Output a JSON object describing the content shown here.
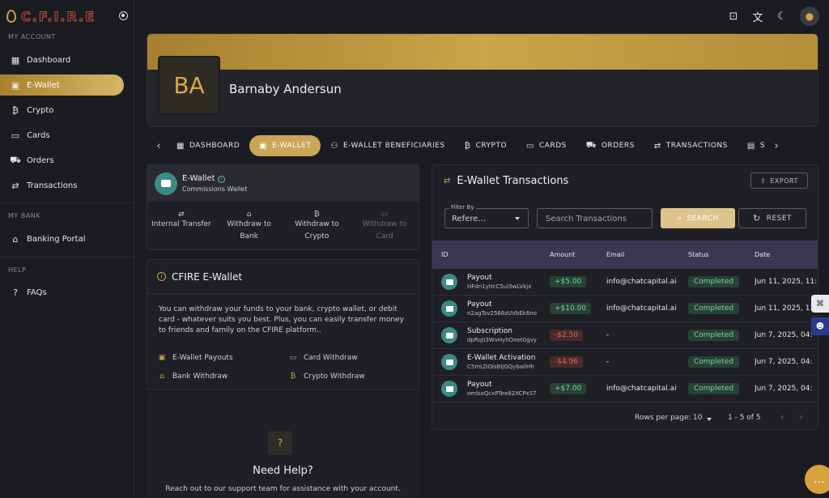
{
  "brand": {
    "logo_text": "C.F.I.R.E"
  },
  "sidebar": {
    "sections": [
      {
        "title": "MY ACCOUNT"
      },
      {
        "title": "MY BANK"
      },
      {
        "title": "HELP"
      }
    ],
    "items": [
      {
        "label": "Dashboard",
        "icon": "dashboard-icon"
      },
      {
        "label": "E-Wallet",
        "icon": "wallet-icon",
        "active": true
      },
      {
        "label": "Crypto",
        "icon": "bitcoin-icon"
      },
      {
        "label": "Cards",
        "icon": "card-icon"
      },
      {
        "label": "Orders",
        "icon": "cart-icon"
      },
      {
        "label": "Transactions",
        "icon": "swap-icon"
      },
      {
        "label": "Banking Portal",
        "icon": "bank-icon"
      },
      {
        "label": "FAQs",
        "icon": "faq-icon"
      }
    ]
  },
  "topbar": {
    "icons": [
      "presentation-icon",
      "translate-icon",
      "dark-mode-icon",
      "user-icon"
    ]
  },
  "profile": {
    "initials": "BA",
    "name": "Barnaby Andersun"
  },
  "tabs": [
    {
      "label": "DASHBOARD",
      "icon": "dashboard-icon"
    },
    {
      "label": "E-WALLET",
      "icon": "wallet-icon",
      "active": true
    },
    {
      "label": "E-WALLET BENEFICIARIES",
      "icon": "people-icon"
    },
    {
      "label": "CRYPTO",
      "icon": "bitcoin-icon"
    },
    {
      "label": "CARDS",
      "icon": "card-icon"
    },
    {
      "label": "ORDERS",
      "icon": "cart-icon"
    },
    {
      "label": "TRANSACTIONS",
      "icon": "swap-icon"
    },
    {
      "label": "S",
      "icon": "settings-icon"
    }
  ],
  "ewallet": {
    "title": "E-Wallet",
    "subtitle": "Commissions Wallet",
    "actions": [
      {
        "label": "Internal Transfer",
        "icon": "swap-icon"
      },
      {
        "label": "Withdraw to Bank",
        "icon": "bank-icon"
      },
      {
        "label": "Withdraw to Crypto",
        "icon": "bitcoin-icon"
      },
      {
        "label": "Withdraw to Card",
        "icon": "card-icon",
        "disabled": true
      }
    ]
  },
  "info": {
    "title": "CFIRE E-Wallet",
    "description": "You can withdraw your funds to your bank, crypto wallet, or debit card - whatever suits you best. Plus, you can easily transfer money to friends and family on the CFIRE platform..",
    "links": [
      {
        "label": "E-Wallet Payouts",
        "icon": "payout-icon"
      },
      {
        "label": "Card Withdraw",
        "icon": "card-icon"
      },
      {
        "label": "Bank Withdraw",
        "icon": "bank-icon"
      },
      {
        "label": "Crypto Withdraw",
        "icon": "bitcoin-icon"
      }
    ]
  },
  "help": {
    "title": "Need Help?",
    "subtitle": "Reach out to our support team for assistance with your account."
  },
  "transactions": {
    "title": "E-Wallet Transactions",
    "export_label": "EXPORT",
    "filter_label": "Filter By",
    "filter_value": "Refere...",
    "search_placeholder": "Search Transactions",
    "search_label": "SEARCH",
    "reset_label": "RESET",
    "columns": [
      "ID",
      "Amount",
      "Email",
      "Status",
      "Date"
    ],
    "rows": [
      {
        "type": "Payout",
        "ref": "HFdn1ytIcC5ul3wLVkjx",
        "amount": "+$5.00",
        "sign": "pos",
        "email": "info@chatcapital.ai",
        "status": "Completed",
        "date": "Jun 11, 2025, 11:"
      },
      {
        "type": "Payout",
        "ref": "n2agTsv2566zUVbEk6no",
        "amount": "+$10.00",
        "sign": "pos",
        "email": "info@chatcapital.ai",
        "status": "Completed",
        "date": "Jun 11, 2025, 11:"
      },
      {
        "type": "Subscription",
        "ref": "dpRqII3WvHyhOnet0gvy",
        "amount": "-$2.50",
        "sign": "neg",
        "email": "-",
        "status": "Completed",
        "date": "Jun 7, 2025, 04:"
      },
      {
        "type": "E-Wallet Activation",
        "ref": "C5mLDOlsBljGQyballHh",
        "amount": "-$4.96",
        "sign": "neg",
        "email": "-",
        "status": "Completed",
        "date": "Jun 7, 2025, 04:"
      },
      {
        "type": "Payout",
        "ref": "omlsxQcxPTee82XCPxS7",
        "amount": "+$7.00",
        "sign": "pos",
        "email": "info@chatcapital.ai",
        "status": "Completed",
        "date": "Jun 7, 2025, 04:"
      }
    ],
    "rows_per_page_label": "Rows per page:",
    "rows_per_page": "10",
    "range": "1 - 5 of 5"
  },
  "colors": {
    "accent": "#c9a65a",
    "success": "#7fd2a2",
    "danger": "#e06a5a",
    "header_row": "#3a3752"
  }
}
